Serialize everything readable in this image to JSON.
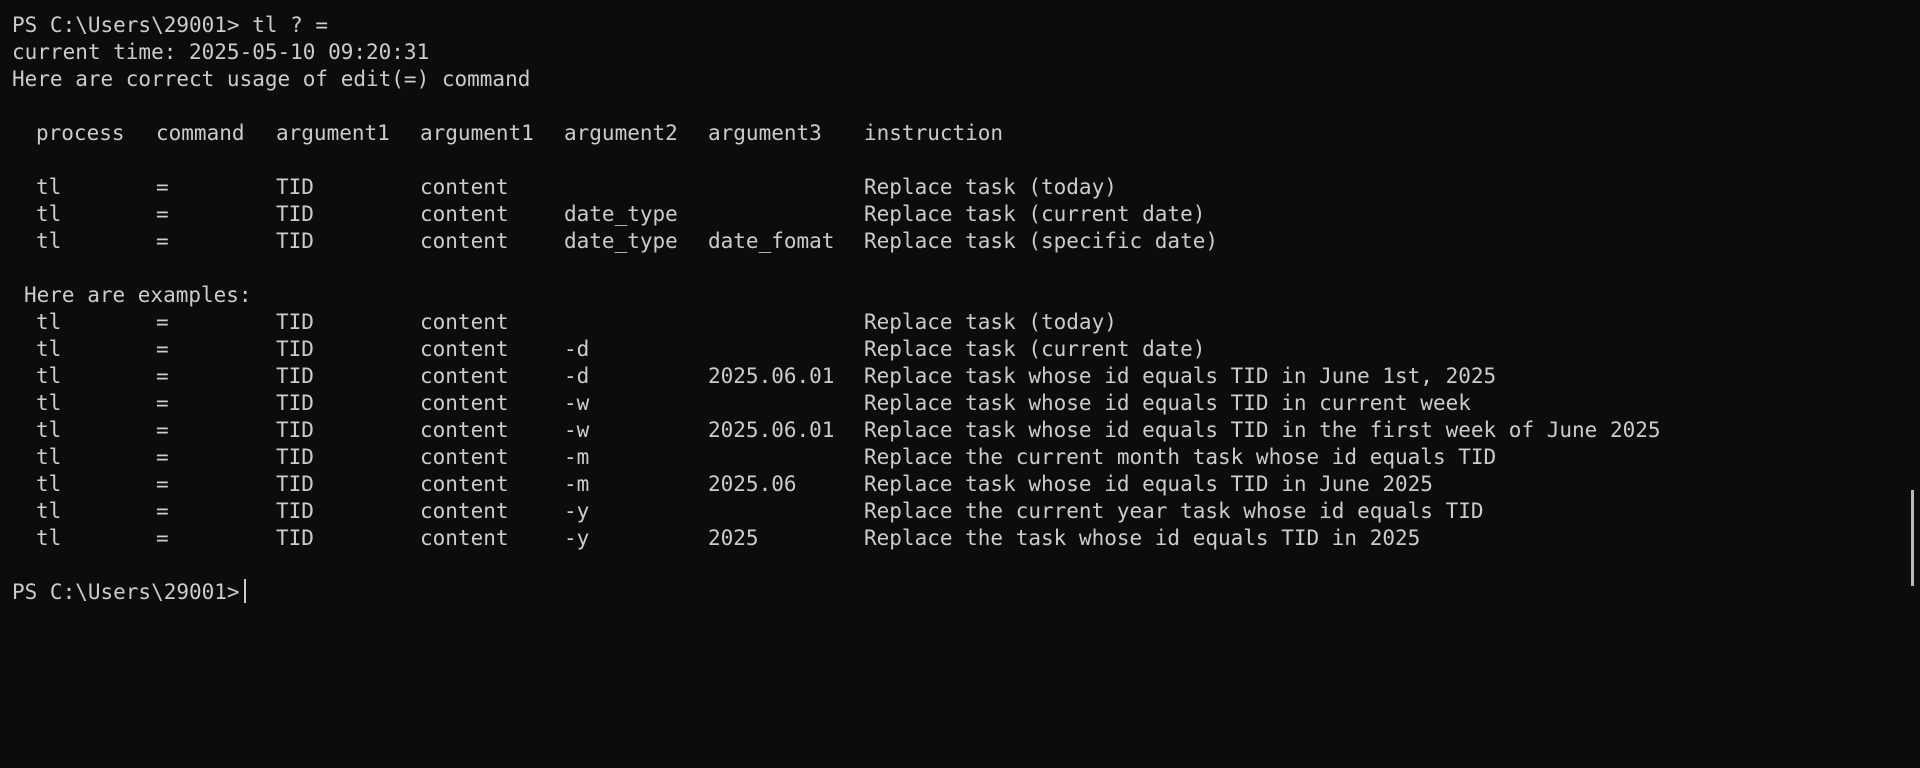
{
  "terminal": {
    "prompt_line": "PS C:\\Users\\29001> tl ? =",
    "time_line": "current time: 2025-05-10 09:20:31",
    "usage_line": "Here are correct usage of edit(=) command",
    "examples_heading": "Here are examples:",
    "final_prompt": "PS C:\\Users\\29001>"
  },
  "usage_table": {
    "headers": [
      "process",
      "command",
      "argument1",
      "argument1",
      "argument2",
      "argument3",
      "instruction"
    ],
    "rows": [
      [
        "tl",
        "=",
        "TID",
        "content",
        "",
        "",
        "Replace task (today)"
      ],
      [
        "tl",
        "=",
        "TID",
        "content",
        "date_type",
        "",
        "Replace task (current date)"
      ],
      [
        "tl",
        "=",
        "TID",
        "content",
        "date_type",
        "date_fomat",
        "Replace task (specific date)"
      ]
    ]
  },
  "examples_table": {
    "rows": [
      [
        "tl",
        "=",
        "TID",
        "content",
        "",
        "",
        "Replace task (today)"
      ],
      [
        "tl",
        "=",
        "TID",
        "content",
        "-d",
        "",
        "Replace task (current date)"
      ],
      [
        "tl",
        "=",
        "TID",
        "content",
        "-d",
        "2025.06.01",
        "Replace task whose id equals TID in June 1st, 2025"
      ],
      [
        "tl",
        "=",
        "TID",
        "content",
        "-w",
        "",
        "Replace task whose id equals TID in current week"
      ],
      [
        "tl",
        "=",
        "TID",
        "content",
        "-w",
        "2025.06.01",
        "Replace task whose id equals TID in the first week of June 2025"
      ],
      [
        "tl",
        "=",
        "TID",
        "content",
        "-m",
        "",
        "Replace the current month task whose id equals TID"
      ],
      [
        "tl",
        "=",
        "TID",
        "content",
        "-m",
        "2025.06",
        "Replace task whose id equals TID in June 2025"
      ],
      [
        "tl",
        "=",
        "TID",
        "content",
        "-y",
        "",
        "Replace the current year task whose id equals TID"
      ],
      [
        "tl",
        "=",
        "TID",
        "content",
        "-y",
        "2025",
        "Replace the task whose id equals TID in 2025"
      ]
    ]
  }
}
